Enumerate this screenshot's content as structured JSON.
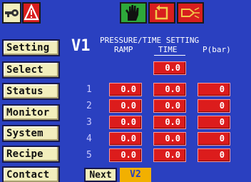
{
  "header": {
    "page_id": "V1",
    "title": "PRESSURE/TIME SETTING",
    "columns": [
      "RAMP",
      "TIME",
      "P(bar)"
    ]
  },
  "icons": {
    "key": "key-icon",
    "alarm": "alarm-triangle-icon",
    "manual": "hand-icon",
    "cycle": "cycle-arrow-icon",
    "valve": "valve-icon"
  },
  "nav": {
    "items": [
      {
        "label": "Setting"
      },
      {
        "label": "Select"
      },
      {
        "label": "Status"
      },
      {
        "label": "Monitor"
      },
      {
        "label": "System"
      },
      {
        "label": "Recipe"
      },
      {
        "label": "Contact"
      }
    ]
  },
  "initial_time": "0.0",
  "steps": [
    {
      "num": "1",
      "ramp": "0.0",
      "time": "0.0",
      "pressure": "0"
    },
    {
      "num": "2",
      "ramp": "0.0",
      "time": "0.0",
      "pressure": "0"
    },
    {
      "num": "3",
      "ramp": "0.0",
      "time": "0.0",
      "pressure": "0"
    },
    {
      "num": "4",
      "ramp": "0.0",
      "time": "0.0",
      "pressure": "0"
    },
    {
      "num": "5",
      "ramp": "0.0",
      "time": "0.0",
      "pressure": "0"
    }
  ],
  "footer": {
    "next_label": "Next",
    "page_label": "V2"
  },
  "colors": {
    "background": "#2a40c0",
    "value_box": "#dc1c1c",
    "nav_button": "#f2eebc",
    "page_tab": "#f2b000",
    "top_green": "#2ea83a",
    "top_red": "#d81e1e"
  }
}
